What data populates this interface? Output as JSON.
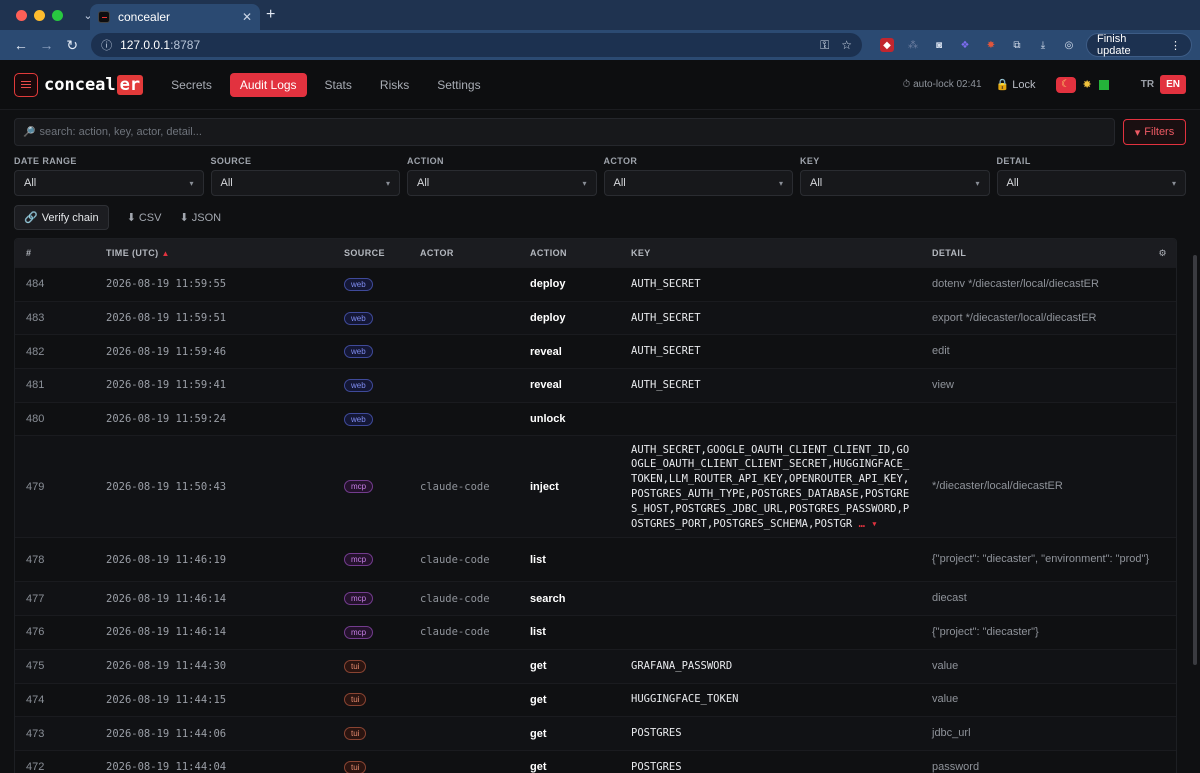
{
  "browser": {
    "tab_title": "concealer",
    "url_host": "127.0.0.1",
    "url_port": ":8787",
    "finish_update": "Finish update"
  },
  "app": {
    "brand_main": "conceal",
    "brand_suffix": "er",
    "nav": [
      "Secrets",
      "Audit Logs",
      "Stats",
      "Risks",
      "Settings"
    ],
    "active_nav": "Audit Logs",
    "autolock": "auto-lock 02:41",
    "lock_label": "Lock",
    "langs": [
      "TR",
      "EN"
    ],
    "active_lang": "EN",
    "accent": "#e2323f"
  },
  "filters": {
    "search_placeholder": "search: action, key, actor, detail...",
    "filters_button": "Filters",
    "selects": [
      {
        "label": "DATE RANGE",
        "value": "All"
      },
      {
        "label": "SOURCE",
        "value": "All"
      },
      {
        "label": "ACTION",
        "value": "All"
      },
      {
        "label": "ACTOR",
        "value": "All"
      },
      {
        "label": "KEY",
        "value": "All"
      },
      {
        "label": "DETAIL",
        "value": "All"
      }
    ],
    "verify_chain": "Verify chain",
    "export_csv": "CSV",
    "export_json": "JSON"
  },
  "table": {
    "headers": [
      "#",
      "TIME (UTC)",
      "SOURCE",
      "ACTOR",
      "ACTION",
      "KEY",
      "DETAIL"
    ],
    "rows": [
      {
        "n": "484",
        "time": "2026-08-19 11:59:55",
        "source": "web",
        "actor": "",
        "action": "deploy",
        "key": "AUTH_SECRET",
        "detail": "dotenv */diecaster/local/diecastER"
      },
      {
        "n": "483",
        "time": "2026-08-19 11:59:51",
        "source": "web",
        "actor": "",
        "action": "deploy",
        "key": "AUTH_SECRET",
        "detail": "export */diecaster/local/diecastER"
      },
      {
        "n": "482",
        "time": "2026-08-19 11:59:46",
        "source": "web",
        "actor": "",
        "action": "reveal",
        "key": "AUTH_SECRET",
        "detail": "edit"
      },
      {
        "n": "481",
        "time": "2026-08-19 11:59:41",
        "source": "web",
        "actor": "",
        "action": "reveal",
        "key": "AUTH_SECRET",
        "detail": "view"
      },
      {
        "n": "480",
        "time": "2026-08-19 11:59:24",
        "source": "web",
        "actor": "",
        "action": "unlock",
        "key": "",
        "detail": ""
      },
      {
        "n": "479",
        "time": "2026-08-19 11:50:43",
        "source": "mcp",
        "actor": "claude-code",
        "action": "inject",
        "key": "AUTH_SECRET,GOOGLE_OAUTH_CLIENT_CLIENT_ID,GOOGLE_OAUTH_CLIENT_CLIENT_SECRET,HUGGINGFACE_TOKEN,LLM_ROUTER_API_KEY,OPENROUTER_API_KEY,POSTGRES_AUTH_TYPE,POSTGRES_DATABASE,POSTGRES_HOST,POSTGRES_JDBC_URL,POSTGRES_PASSWORD,POSTGRES_PORT,POSTGRES_SCHEMA,POSTGR",
        "key_more": "… ▾",
        "detail": "*/diecaster/local/diecastER"
      },
      {
        "n": "478",
        "time": "2026-08-19 11:46:19",
        "source": "mcp",
        "actor": "claude-code",
        "action": "list",
        "key": "",
        "detail": "{\"project\": \"diecaster\", \"environment\": \"prod\"}"
      },
      {
        "n": "477",
        "time": "2026-08-19 11:46:14",
        "source": "mcp",
        "actor": "claude-code",
        "action": "search",
        "key": "",
        "detail": "diecast"
      },
      {
        "n": "476",
        "time": "2026-08-19 11:46:14",
        "source": "mcp",
        "actor": "claude-code",
        "action": "list",
        "key": "",
        "detail": "{\"project\": \"diecaster\"}"
      },
      {
        "n": "475",
        "time": "2026-08-19 11:44:30",
        "source": "tui",
        "actor": "",
        "action": "get",
        "key": "GRAFANA_PASSWORD",
        "detail": "value"
      },
      {
        "n": "474",
        "time": "2026-08-19 11:44:15",
        "source": "tui",
        "actor": "",
        "action": "get",
        "key": "HUGGINGFACE_TOKEN",
        "detail": "value"
      },
      {
        "n": "473",
        "time": "2026-08-19 11:44:06",
        "source": "tui",
        "actor": "",
        "action": "get",
        "key": "POSTGRES",
        "detail": "jdbc_url"
      },
      {
        "n": "472",
        "time": "2026-08-19 11:44:04",
        "source": "tui",
        "actor": "",
        "action": "get",
        "key": "POSTGRES",
        "detail": "password"
      }
    ]
  }
}
